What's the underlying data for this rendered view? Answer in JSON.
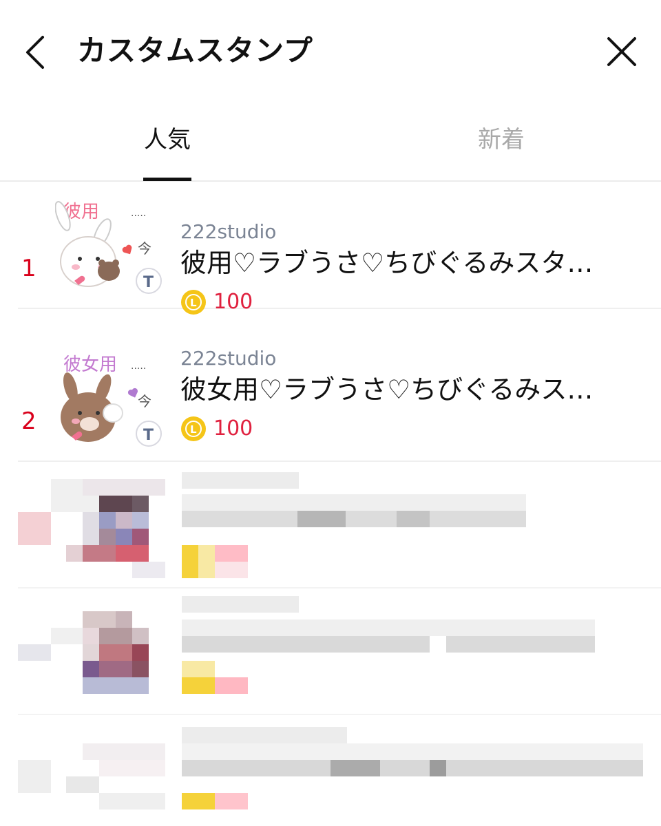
{
  "header": {
    "title": "カスタムスタンプ"
  },
  "tabs": [
    {
      "label": "人気",
      "active": true
    },
    {
      "label": "新着",
      "active": false
    }
  ],
  "items": [
    {
      "rank": "1",
      "author": "222studio",
      "title": "彼用♡ラブうさ♡ちびぐるみスタ…",
      "price": "100",
      "thumb_text": "彼用",
      "thumb_badge": "T"
    },
    {
      "rank": "2",
      "author": "222studio",
      "title": "彼女用♡ラブうさ♡ちびぐるみス…",
      "price": "100",
      "thumb_text": "彼女用",
      "thumb_badge": "T"
    }
  ],
  "coin_letter": "L",
  "colors": {
    "rank": "#d9001b",
    "price": "#e0213f",
    "coin": "#f5c518",
    "author": "#7b8494",
    "inactive_tab": "#a9a9a9"
  },
  "icons": {
    "back": "chevron-left-icon",
    "close": "close-icon",
    "coin": "line-coin-icon"
  }
}
